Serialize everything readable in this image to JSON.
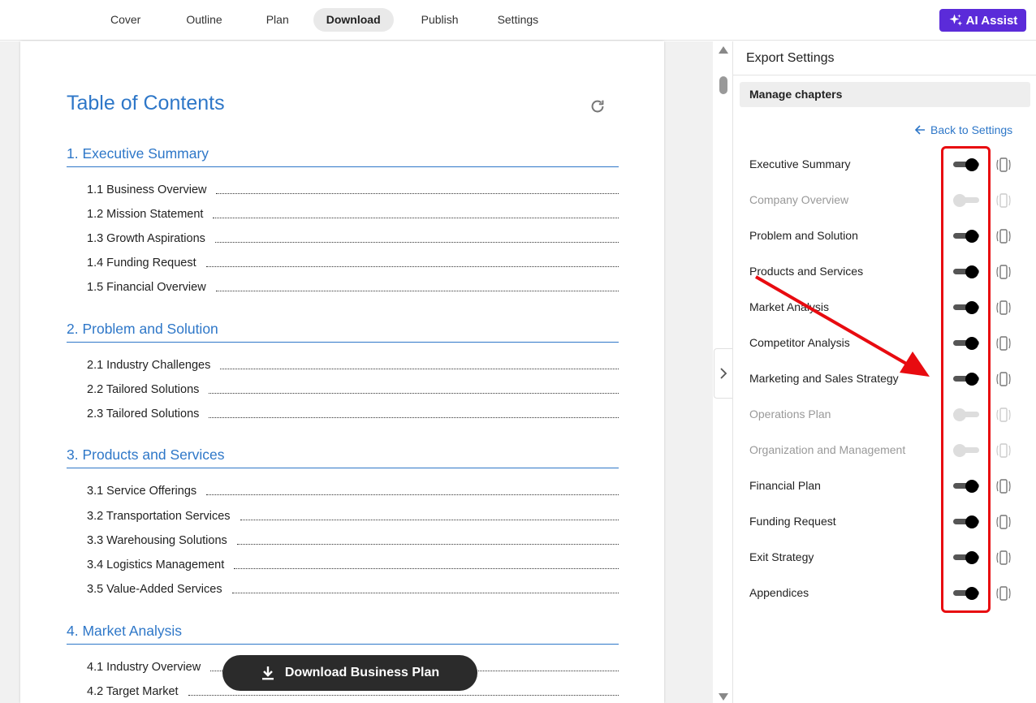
{
  "nav": {
    "tabs": [
      "Cover",
      "Outline",
      "Plan",
      "Download",
      "Publish",
      "Settings"
    ],
    "active_tab": "Download",
    "ai_assist_label": "AI Assist"
  },
  "document": {
    "toc_title": "Table of Contents",
    "sections": [
      {
        "heading": "1. Executive Summary",
        "entries": [
          "1.1 Business Overview",
          "1.2 Mission Statement",
          "1.3 Growth Aspirations",
          "1.4 Funding Request",
          "1.5 Financial Overview"
        ]
      },
      {
        "heading": "2. Problem and Solution",
        "entries": [
          "2.1 Industry Challenges",
          "2.2 Tailored Solutions",
          "2.3 Tailored Solutions"
        ]
      },
      {
        "heading": "3. Products and Services",
        "entries": [
          "3.1 Service Offerings",
          "3.2 Transportation Services",
          "3.3 Warehousing Solutions",
          "3.4 Logistics Management",
          "3.5 Value-Added Services"
        ]
      },
      {
        "heading": "4. Market Analysis",
        "entries": [
          "4.1 Industry Overview",
          "4.2 Target Market"
        ]
      }
    ],
    "download_button_label": "Download Business Plan"
  },
  "export_panel": {
    "title": "Export Settings",
    "manage_label": "Manage chapters",
    "back_label": "Back to Settings",
    "chapters": [
      {
        "label": "Executive Summary",
        "enabled": true
      },
      {
        "label": "Company Overview",
        "enabled": false
      },
      {
        "label": "Problem and Solution",
        "enabled": true
      },
      {
        "label": "Products and Services",
        "enabled": true
      },
      {
        "label": "Market Analysis",
        "enabled": true
      },
      {
        "label": "Competitor Analysis",
        "enabled": true
      },
      {
        "label": "Marketing and Sales Strategy",
        "enabled": true
      },
      {
        "label": "Operations Plan",
        "enabled": false
      },
      {
        "label": "Organization and Management",
        "enabled": false
      },
      {
        "label": "Financial Plan",
        "enabled": true
      },
      {
        "label": "Funding Request",
        "enabled": true
      },
      {
        "label": "Exit Strategy",
        "enabled": true
      },
      {
        "label": "Appendices",
        "enabled": true
      }
    ]
  },
  "colors": {
    "accent": "#2e77c8",
    "ai_button": "#5b2bd9",
    "annotation_red": "#e80b10"
  }
}
